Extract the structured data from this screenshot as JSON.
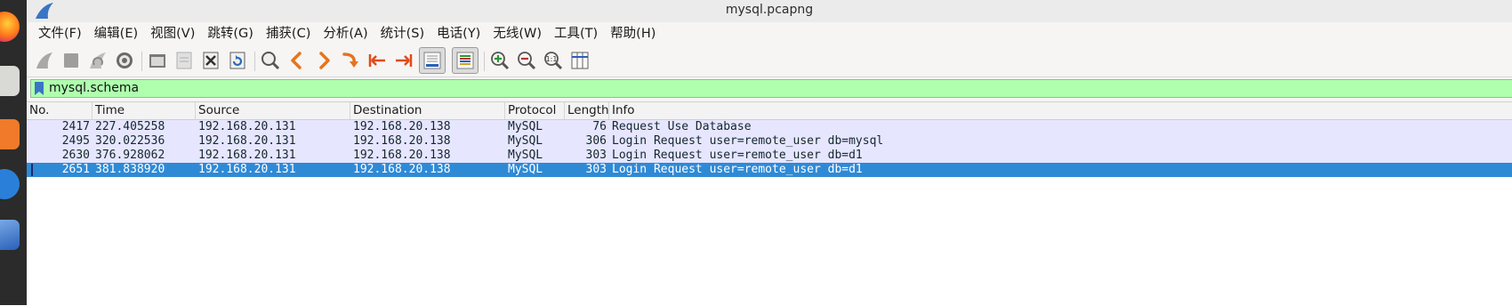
{
  "window": {
    "title": "mysql.pcapng"
  },
  "menubar": {
    "items": [
      "文件(F)",
      "编辑(E)",
      "视图(V)",
      "跳转(G)",
      "捕获(C)",
      "分析(A)",
      "统计(S)",
      "电话(Y)",
      "无线(W)",
      "工具(T)",
      "帮助(H)"
    ]
  },
  "toolbar": {
    "buttons": [
      "start-capture-icon",
      "stop-capture-icon",
      "restart-capture-icon",
      "capture-options-icon",
      "open-file-icon",
      "save-file-icon",
      "close-file-icon",
      "reload-file-icon",
      "find-packet-icon",
      "go-back-icon",
      "go-forward-icon",
      "go-to-packet-icon",
      "go-first-packet-icon",
      "go-last-packet-icon",
      "auto-scroll-icon",
      "colorize-icon",
      "zoom-in-icon",
      "zoom-out-icon",
      "normal-size-icon",
      "resize-columns-icon"
    ]
  },
  "filter": {
    "value": "mysql.schema"
  },
  "packet_list": {
    "columns": [
      "No.",
      "Time",
      "Source",
      "Destination",
      "Protocol",
      "Length",
      "Info"
    ],
    "rows": [
      {
        "no": "2417",
        "time": "227.405258",
        "source": "192.168.20.131",
        "destination": "192.168.20.138",
        "protocol": "MySQL",
        "length": "76",
        "info": "Request Use Database"
      },
      {
        "no": "2495",
        "time": "320.022536",
        "source": "192.168.20.131",
        "destination": "192.168.20.138",
        "protocol": "MySQL",
        "length": "306",
        "info": "Login Request user=remote_user db=mysql"
      },
      {
        "no": "2630",
        "time": "376.928062",
        "source": "192.168.20.131",
        "destination": "192.168.20.138",
        "protocol": "MySQL",
        "length": "303",
        "info": "Login Request user=remote_user db=d1"
      },
      {
        "no": "2651",
        "time": "381.838920",
        "source": "192.168.20.131",
        "destination": "192.168.20.138",
        "protocol": "MySQL",
        "length": "303",
        "info": "Login Request user=remote_user db=d1"
      }
    ],
    "selected_row_no": "2651"
  },
  "colors": {
    "filter_background": "#afffaf",
    "row_background": "#e7e6ff",
    "selected_row_background": "#2f8ad6",
    "toolbar_accent_orange": "#e8731c",
    "zoom_icon_green": "#2a9a2a",
    "zoom_icon_red": "#c03030",
    "wireshark_fin_blue": "#3a74c6"
  }
}
